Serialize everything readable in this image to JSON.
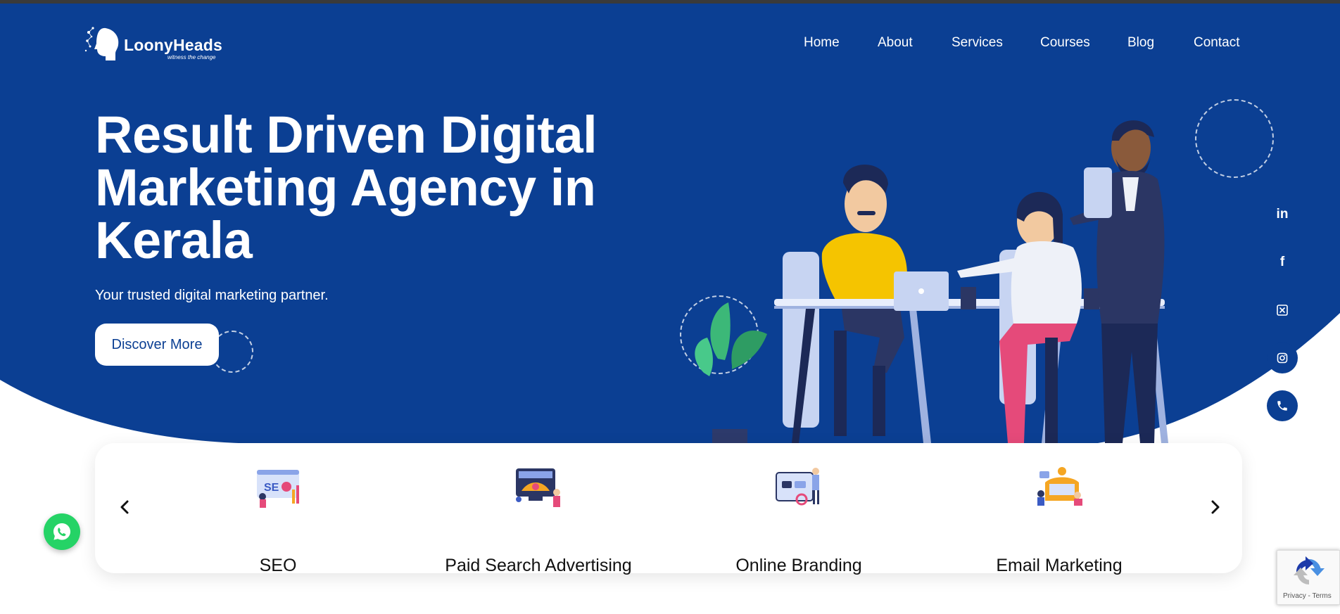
{
  "brand": {
    "name": "LoonyHeads",
    "tagline": "witness the change"
  },
  "nav": [
    "Home",
    "About",
    "Services",
    "Courses",
    "Blog",
    "Contact"
  ],
  "hero": {
    "title_lines": [
      "Result Driven Digital",
      "Marketing Agency in",
      "Kerala"
    ],
    "subtitle": "Your trusted digital marketing partner.",
    "cta_label": "Discover More"
  },
  "social": [
    "linkedin-icon",
    "facebook-icon",
    "x-twitter-icon",
    "instagram-icon",
    "phone-icon"
  ],
  "services": [
    {
      "label": "SEO",
      "icon": "seo-illustration-icon"
    },
    {
      "label": "Paid Search Advertising",
      "icon": "paid-search-illustration-icon"
    },
    {
      "label": "Online Branding",
      "icon": "online-branding-illustration-icon"
    },
    {
      "label": "Email Marketing",
      "icon": "email-marketing-illustration-icon"
    }
  ],
  "recaptcha": {
    "text": "Privacy - Terms"
  },
  "colors": {
    "primary": "#0b3f93",
    "white": "#ffffff",
    "whatsapp": "#25d366"
  }
}
